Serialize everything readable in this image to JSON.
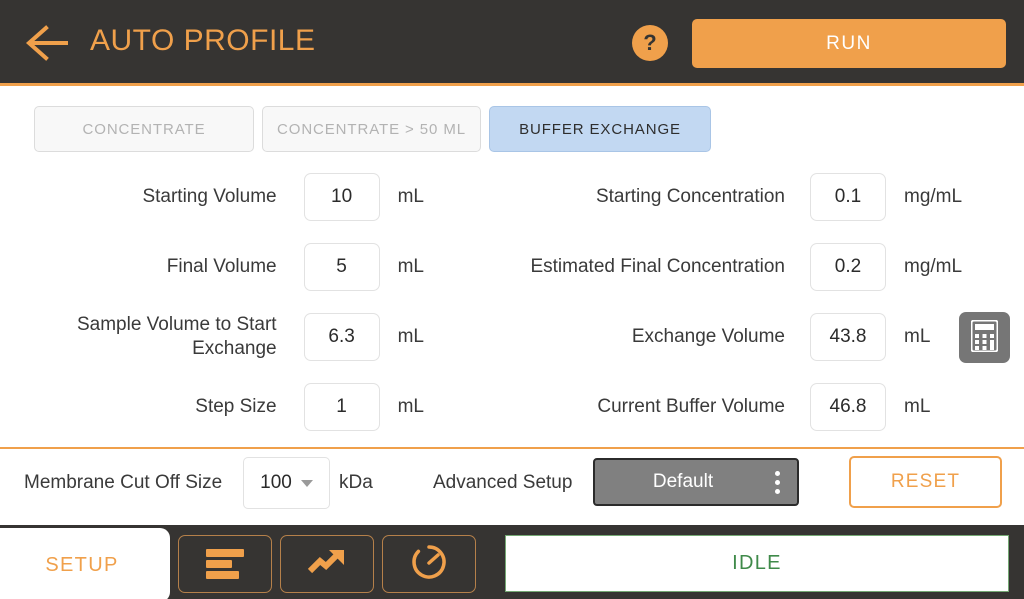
{
  "header": {
    "back_icon": "back-arrow-icon",
    "title": "AUTO PROFILE",
    "help_icon": "?",
    "run_label": "RUN",
    "accent_color": "#f0a04b",
    "bar_color": "#363432"
  },
  "tabs": [
    {
      "label": "CONCENTRATE",
      "active": false
    },
    {
      "label": "CONCENTRATE > 50 ML",
      "active": false
    },
    {
      "label": "BUFFER EXCHANGE",
      "active": true
    }
  ],
  "tab_active_color": "#c2d8f2",
  "form": {
    "left": [
      {
        "label": "Starting Volume",
        "value": "10",
        "unit": "mL"
      },
      {
        "label": "Final Volume",
        "value": "5",
        "unit": "mL"
      },
      {
        "label": "Sample Volume to Start Exchange",
        "value": "6.3",
        "unit": "mL"
      },
      {
        "label": "Step Size",
        "value": "1",
        "unit": "mL"
      }
    ],
    "right": [
      {
        "label": "Starting Concentration",
        "value": "0.1",
        "unit": "mg/mL"
      },
      {
        "label": "Estimated Final Concentration",
        "value": "0.2",
        "unit": "mg/mL"
      },
      {
        "label": "Exchange Volume",
        "value": "43.8",
        "unit": "mL"
      },
      {
        "label": "Current Buffer Volume",
        "value": "46.8",
        "unit": "mL"
      }
    ],
    "calculator_icon": "calculator-icon"
  },
  "settings": {
    "membrane_label": "Membrane Cut Off Size",
    "membrane_value": "100",
    "membrane_unit": "kDa",
    "advanced_label": "Advanced Setup",
    "advanced_value": "Default",
    "advanced_menu_icon": "kebab-menu-icon",
    "reset_label": "RESET"
  },
  "bottom": {
    "setup_label": "SETUP",
    "nav": [
      {
        "icon": "list-bars-icon"
      },
      {
        "icon": "trending-up-icon"
      },
      {
        "icon": "gauge-icon"
      }
    ],
    "status": "IDLE",
    "status_color": "#3f8a4a"
  }
}
